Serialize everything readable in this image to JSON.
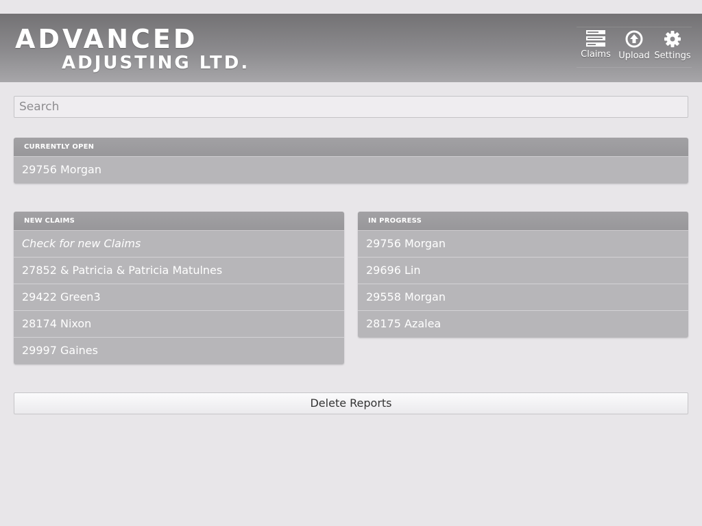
{
  "header": {
    "logo_line1": "ADVANCED",
    "logo_line2": "ADJUSTING LTD.",
    "buttons": [
      {
        "label": "Claims",
        "icon": "claims-list-icon"
      },
      {
        "label": "Upload",
        "icon": "upload-icon"
      },
      {
        "label": "Settings",
        "icon": "gear-icon"
      }
    ]
  },
  "search": {
    "placeholder": "Search",
    "value": ""
  },
  "currently_open": {
    "title": "CURRENTLY OPEN",
    "items": [
      "29756 Morgan"
    ]
  },
  "new_claims": {
    "title": "NEW CLAIMS",
    "items": [
      "Check for new Claims",
      "27852 & Patricia & Patricia Matulnes",
      "29422 Green3",
      "28174 Nixon",
      "29997 Gaines"
    ]
  },
  "in_progress": {
    "title": "IN PROGRESS",
    "items": [
      "29756 Morgan",
      "29696 Lin",
      "29558 Morgan",
      "28175 Azalea"
    ]
  },
  "footer": {
    "delete_label": "Delete Reports"
  },
  "colors": {
    "header_bg": "#828184",
    "panel_header": "#9d9c9f",
    "row_bg": "#b7b6b9",
    "page_bg": "#e8e6e9"
  }
}
